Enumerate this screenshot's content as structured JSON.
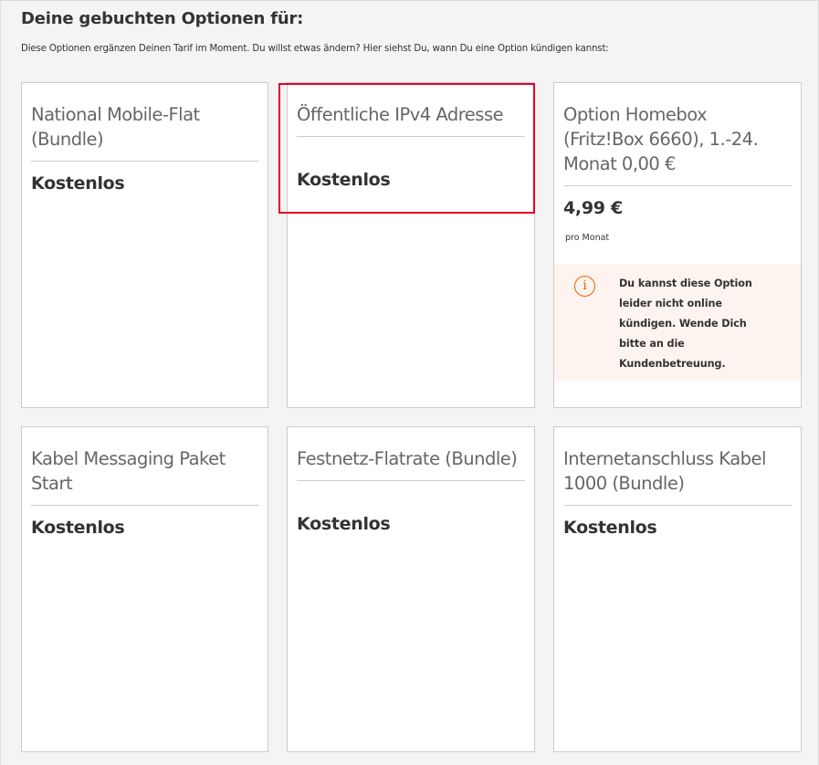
{
  "page": {
    "heading": "Deine gebuchten Optionen für:",
    "subline": "Diese Optionen ergänzen Deinen Tarif im Moment. Du willst etwas ändern? Hier siehst Du, wann Du eine Option kündigen kannst:"
  },
  "options": [
    {
      "title": "National Mobile-Flat (Bundle)",
      "price": "Kostenlos"
    },
    {
      "title": "Öffentliche IPv4 Adresse",
      "price": "Kostenlos"
    },
    {
      "title": "Option Homebox (Fritz!Box 6660), 1.-24. Monat 0,00 €",
      "price": "4,99 €",
      "period": "pro Monat",
      "notice": "Du kannst diese Option leider nicht online kündigen. Wende Dich bitte an die Kundenbetreuung.",
      "notice_icon": "info-icon"
    },
    {
      "title": "Kabel Messaging Paket Start",
      "price": "Kostenlos"
    },
    {
      "title": "Festnetz-Flatrate (Bundle)",
      "price": "Kostenlos"
    },
    {
      "title": "Internetanschluss Kabel 1000 (Bundle)",
      "price": "Kostenlos"
    }
  ],
  "colors": {
    "highlight": "#e60027",
    "notice_background": "#fef4ef",
    "notice_icon": "#eb6100"
  }
}
